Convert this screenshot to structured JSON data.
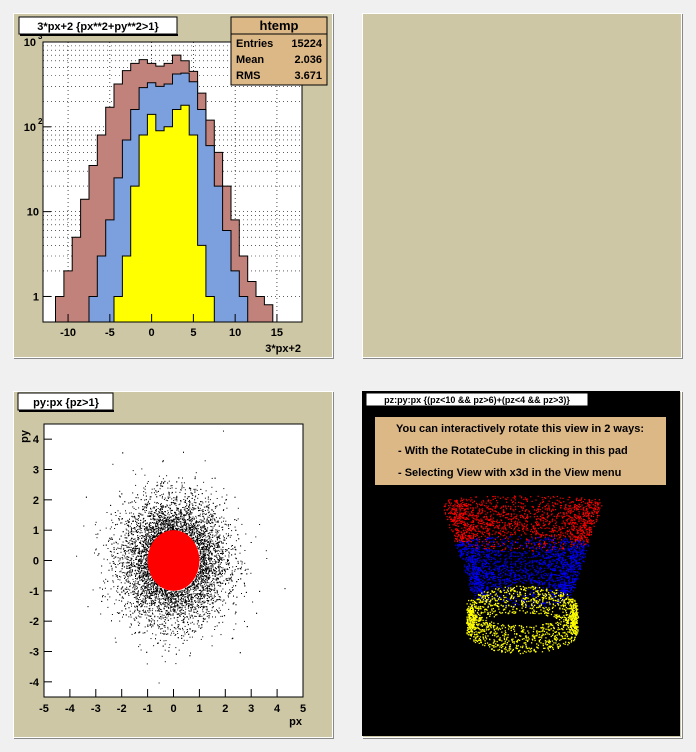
{
  "chart_data": [
    {
      "type": "histogram",
      "title": "3*px+2 {px**2+py**2>1}",
      "xlabel": "3*px+2",
      "ylabel": "",
      "y_scale": "log",
      "xlim": [
        -13,
        18
      ],
      "ylim": [
        0.5,
        1000
      ],
      "x_ticks": [
        "-10",
        "-5",
        "0",
        "5",
        "10",
        "15"
      ],
      "x_tick_values": [
        -10,
        -5,
        0,
        5,
        10,
        15
      ],
      "y_ticks": [
        "1",
        "10",
        "10^2",
        "10^3"
      ],
      "y_tick_values": [
        1,
        10,
        100,
        1000
      ],
      "grid": true,
      "stats_box": {
        "title": "htemp",
        "rows": [
          {
            "label": "Entries",
            "value": "15224"
          },
          {
            "label": "Mean",
            "value": "2.036"
          },
          {
            "label": "RMS",
            "value": "3.671"
          }
        ]
      },
      "series": [
        {
          "fill": "#c0827a",
          "x": [
            -11,
            -10,
            -9,
            -8,
            -7,
            -6,
            -5,
            -4,
            -3,
            -2,
            -1,
            0,
            1,
            2,
            3,
            4,
            5,
            6,
            7,
            8,
            9,
            10,
            11,
            12,
            13,
            14
          ],
          "values": [
            1,
            2,
            5,
            14,
            35,
            80,
            170,
            320,
            460,
            560,
            620,
            560,
            520,
            560,
            700,
            600,
            450,
            250,
            120,
            50,
            20,
            8,
            3,
            1.5,
            1,
            0.8
          ]
        },
        {
          "fill": "#7c9fde",
          "x": [
            -7,
            -6,
            -5,
            -4,
            -3,
            -2,
            -1,
            0,
            1,
            2,
            3,
            4,
            5,
            6,
            7,
            8,
            9,
            10,
            11
          ],
          "values": [
            1,
            3,
            8,
            25,
            70,
            160,
            290,
            330,
            300,
            320,
            420,
            430,
            340,
            160,
            60,
            20,
            6,
            2,
            1
          ]
        },
        {
          "fill": "#ffff00",
          "x": [
            -4,
            -3,
            -2,
            -1,
            0,
            1,
            2,
            3,
            4,
            5,
            6,
            7
          ],
          "values": [
            1,
            3,
            20,
            80,
            140,
            90,
            100,
            160,
            180,
            80,
            4,
            1
          ]
        }
      ]
    },
    {
      "type": "scatter",
      "title": "py:px {pz>1}",
      "xlabel": "px",
      "ylabel": "py",
      "xlim": [
        -5,
        5
      ],
      "ylim": [
        -4.5,
        4.5
      ],
      "x_ticks": [
        "-5",
        "-4",
        "-3",
        "-2",
        "-1",
        "0",
        "1",
        "2",
        "3",
        "4",
        "5"
      ],
      "y_ticks": [
        "-4",
        "-3",
        "-2",
        "-1",
        "0",
        "1",
        "2",
        "3",
        "4"
      ],
      "series": [
        {
          "name": "",
          "color": "#000000",
          "distribution": "gaussian",
          "sigma": 1.0,
          "n": 9000
        },
        {
          "name": "",
          "color": "#ff0000",
          "shape": "disk",
          "radius": 1.0
        }
      ]
    },
    {
      "type": "scatter3d",
      "title": "pz:py:px {(pz<10 && pz>6)+(pz<4 && pz>3)}",
      "background": "#000000",
      "series": [
        {
          "name": "",
          "color": "#ff0000"
        },
        {
          "name": "",
          "color": "#0000ff"
        },
        {
          "name": "",
          "color": "#ffff00"
        }
      ]
    }
  ],
  "empty_pad_color": "#cdc7a5",
  "info_box": {
    "lines": [
      "You can interactively rotate this view in 2 ways:",
      "  - With the RotateCube in clicking in this pad",
      "  - Selecting View with x3d in the View menu"
    ],
    "color": "#ddb887"
  }
}
